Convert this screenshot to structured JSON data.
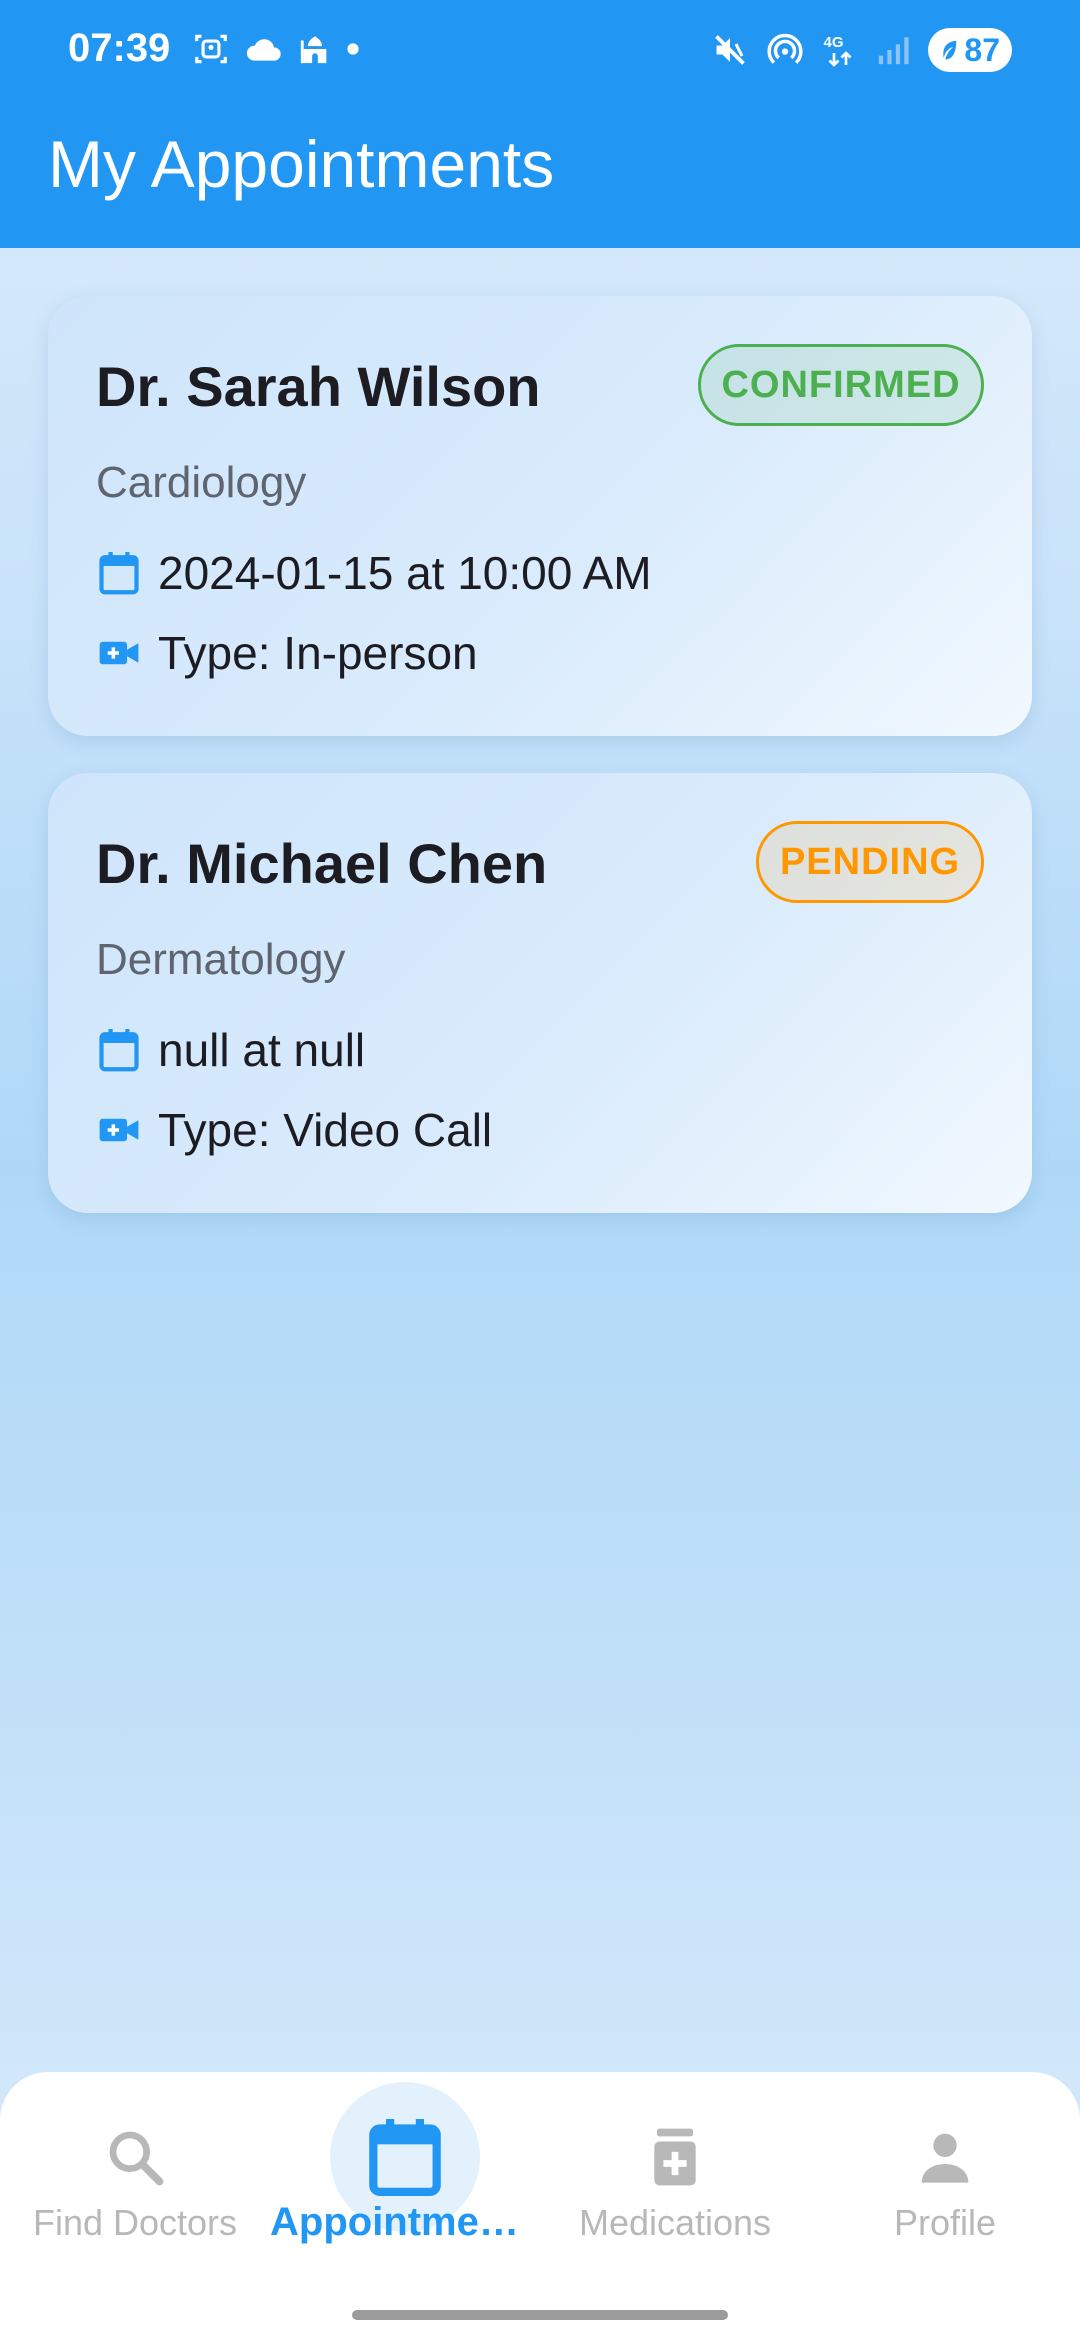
{
  "status_bar": {
    "time": "07:39",
    "battery": "87",
    "left_icons": [
      "screenshot-icon",
      "cloud-icon",
      "mosque-icon",
      "dot-icon"
    ],
    "right_icons": [
      "mute-icon",
      "hotspot-icon",
      "4g-icon",
      "signal-icon"
    ]
  },
  "app_bar": {
    "title": "My Appointments"
  },
  "appointments": [
    {
      "doctor": "Dr. Sarah Wilson",
      "status": "CONFIRMED",
      "specialty": "Cardiology",
      "datetime": "2024-01-15 at 10:00 AM",
      "type": "Type: In-person"
    },
    {
      "doctor": "Dr. Michael Chen",
      "status": "PENDING",
      "specialty": "Dermatology",
      "datetime": "null at null",
      "type": "Type: Video Call"
    }
  ],
  "bottom_nav": {
    "items": [
      {
        "label": "Find Doctors",
        "icon": "search-icon"
      },
      {
        "label": "Appointmen…",
        "icon": "calendar-icon"
      },
      {
        "label": "Medications",
        "icon": "medication-icon"
      },
      {
        "label": "Profile",
        "icon": "person-icon"
      }
    ],
    "active_index": 1
  },
  "colors": {
    "primary": "#2196f3",
    "confirmed": "#4caf50",
    "pending": "#ff9800"
  }
}
